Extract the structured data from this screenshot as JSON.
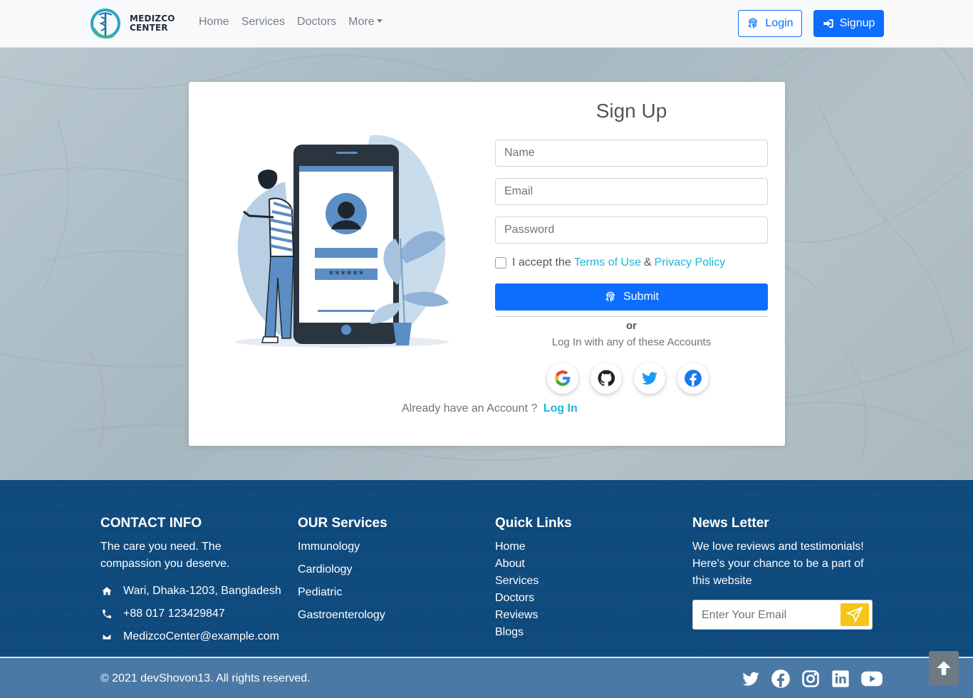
{
  "nav": {
    "logo_line1": "MEDIZCO",
    "logo_line2": "CENTER",
    "links": [
      "Home",
      "Services",
      "Doctors",
      "More"
    ],
    "login_label": "Login",
    "signup_label": "Signup"
  },
  "signup": {
    "title": "Sign Up",
    "name_placeholder": "Name",
    "email_placeholder": "Email",
    "password_placeholder": "Password",
    "accept_prefix": "I accept the",
    "terms_link": "Terms of Use",
    "amp": "&",
    "privacy_link": "Privacy Policy",
    "submit_label": "Submit",
    "or_label": "or",
    "login_with_text": "Log In with any of these Accounts",
    "already_text": "Already have an Account ?",
    "login_link": "Log In",
    "illustration_password": "******"
  },
  "footer": {
    "contact": {
      "title": "CONTACT INFO",
      "tagline": "The care you need. The compassion you deserve.",
      "address": "Wari, Dhaka-1203, Bangladesh",
      "phone": "+88 017 123429847",
      "email": "MedizcoCenter@example.com"
    },
    "services": {
      "title": "OUR Services",
      "items": [
        "Immunology",
        "Cardiology",
        "Pediatric",
        "Gastroenterology"
      ]
    },
    "quick_links": {
      "title": "Quick Links",
      "items": [
        "Home",
        "About",
        "Services",
        "Doctors",
        "Reviews",
        "Blogs"
      ]
    },
    "newsletter": {
      "title": "News Letter",
      "text": "We love reviews and testimonials! Here's your chance to be a part of this website",
      "email_placeholder": "Enter Your Email"
    },
    "copyright": "© 2021 devShovon13. All rights reserved."
  },
  "colors": {
    "primary": "#0d6efd",
    "cyan_link": "#1ab8d8",
    "footer_bg": "#0f4a7d",
    "bottom_bar": "#4b79a6",
    "newsletter_button": "#f5c518"
  }
}
